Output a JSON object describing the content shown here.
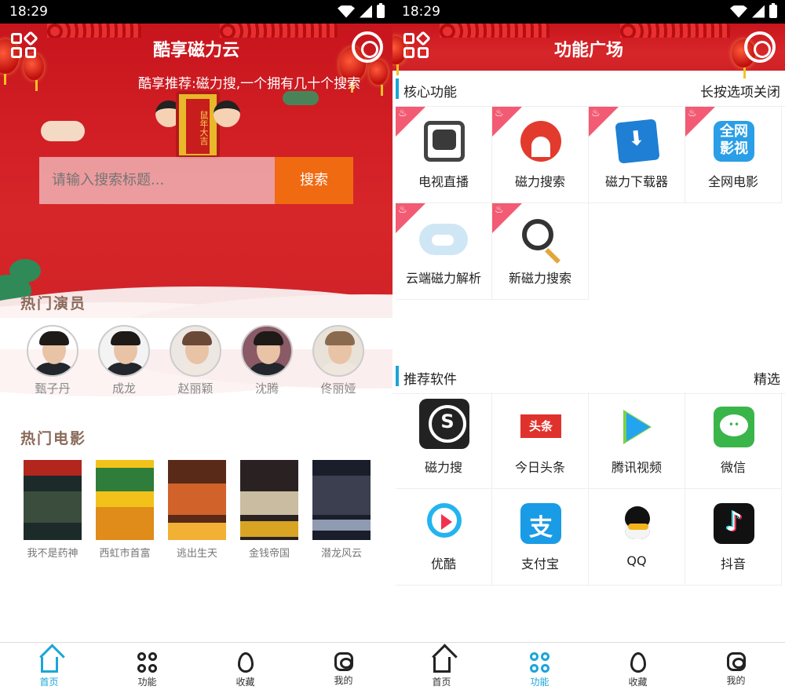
{
  "status_bar": {
    "time": "18:29"
  },
  "left_screen": {
    "header": {
      "title": "酷享磁力云"
    },
    "marquee": "酷享推荐:磁力搜,一个拥有几十个搜索",
    "mascot_text": "鼠年大吉",
    "search": {
      "placeholder": "请输入搜索标题...",
      "button_label": "搜索"
    },
    "actors_section": {
      "title": "热门演员",
      "items": [
        {
          "name": "甄子丹"
        },
        {
          "name": "成龙"
        },
        {
          "name": "赵丽颖"
        },
        {
          "name": "沈腾"
        },
        {
          "name": "佟丽娅"
        }
      ]
    },
    "movies_section": {
      "title": "热门电影",
      "items": [
        {
          "name": "我不是药神"
        },
        {
          "name": "西虹市首富"
        },
        {
          "name": "逃出生天"
        },
        {
          "name": "金钱帝国"
        },
        {
          "name": "潜龙风云"
        }
      ]
    },
    "bottom_nav": [
      {
        "label": "首页",
        "icon": "home-icon",
        "active": true
      },
      {
        "label": "功能",
        "icon": "function-icon",
        "active": false
      },
      {
        "label": "收藏",
        "icon": "fire-icon",
        "active": false
      },
      {
        "label": "我的",
        "icon": "user-icon",
        "active": false
      }
    ]
  },
  "right_screen": {
    "header": {
      "title": "功能广场"
    },
    "core_section": {
      "title": "核心功能",
      "action": "长按选项关闭",
      "items": [
        {
          "label": "电视直播",
          "icon": "tv-icon"
        },
        {
          "label": "磁力搜索",
          "icon": "magnet-icon"
        },
        {
          "label": "磁力下载器",
          "icon": "download-icon"
        },
        {
          "label": "全网电影",
          "icon": "movie-icon",
          "icon_text": "全网\n影视"
        },
        {
          "label": "云端磁力解析",
          "icon": "cloud-icon"
        },
        {
          "label": "新磁力搜索",
          "icon": "magnifier-icon"
        }
      ]
    },
    "recommend_section": {
      "title": "推荐软件",
      "action": "精选",
      "items": [
        {
          "label": "磁力搜",
          "icon": "cili-app-icon"
        },
        {
          "label": "今日头条",
          "icon": "toutiao-app-icon"
        },
        {
          "label": "腾讯视频",
          "icon": "tencent-video-app-icon"
        },
        {
          "label": "微信",
          "icon": "wechat-app-icon"
        },
        {
          "label": "优酷",
          "icon": "youku-app-icon"
        },
        {
          "label": "支付宝",
          "icon": "alipay-app-icon"
        },
        {
          "label": "QQ",
          "icon": "qq-app-icon"
        },
        {
          "label": "抖音",
          "icon": "douyin-app-icon"
        }
      ]
    },
    "bottom_nav": [
      {
        "label": "首页",
        "icon": "home-icon",
        "active": false
      },
      {
        "label": "功能",
        "icon": "function-icon",
        "active": true
      },
      {
        "label": "收藏",
        "icon": "fire-icon",
        "active": false
      },
      {
        "label": "我的",
        "icon": "user-icon",
        "active": false
      }
    ]
  },
  "colors": {
    "header_red": "#c8151d",
    "search_button": "#f06a12",
    "accent_blue": "#1aa6d9",
    "hot_ribbon": "#f25b73"
  }
}
